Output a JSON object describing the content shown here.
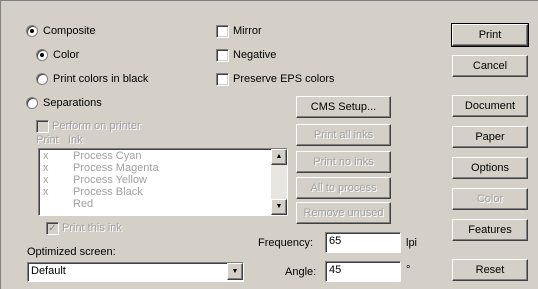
{
  "output_mode": {
    "composite": "Composite",
    "color": "Color",
    "print_colors_in_black": "Print colors in black",
    "separations": "Separations"
  },
  "options": {
    "mirror": "Mirror",
    "negative": "Negative",
    "preserve_eps": "Preserve EPS colors"
  },
  "separations": {
    "perform_on_printer": "Perform on printer",
    "col_print": "Print",
    "col_ink": "Ink",
    "inks": [
      {
        "mark": "x",
        "name": "Process Cyan"
      },
      {
        "mark": "x",
        "name": "Process Magenta"
      },
      {
        "mark": "x",
        "name": "Process Yellow"
      },
      {
        "mark": "x",
        "name": "Process Black"
      },
      {
        "mark": "",
        "name": "Red"
      }
    ],
    "print_this_ink": "Print this ink",
    "cms_setup": "CMS Setup...",
    "print_all_inks": "Print all inks",
    "print_no_inks": "Print no inks",
    "all_to_process": "All to process",
    "remove_unused": "Remove unused"
  },
  "screen": {
    "optimized_label": "Optimized screen:",
    "optimized_value": "Default",
    "frequency_label": "Frequency:",
    "frequency_value": "65",
    "frequency_unit": "lpi",
    "angle_label": "Angle:",
    "angle_value": "45",
    "angle_unit": "°"
  },
  "side_buttons": {
    "print": "Print",
    "cancel": "Cancel",
    "document": "Document",
    "paper": "Paper",
    "options": "Options",
    "color": "Color",
    "features": "Features",
    "reset": "Reset"
  }
}
